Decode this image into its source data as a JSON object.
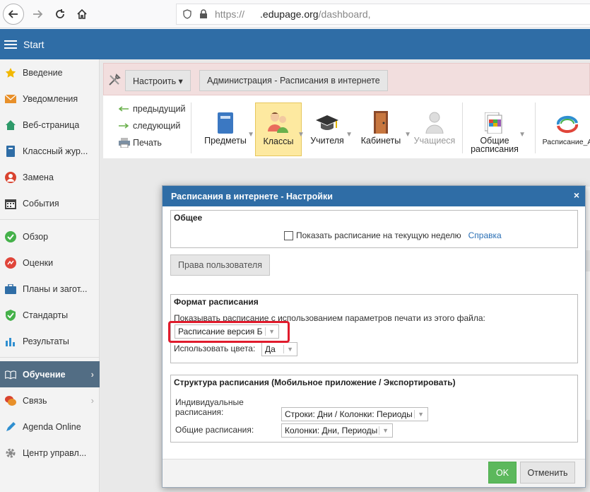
{
  "browser": {
    "url_scheme": "https://",
    "url_host": ".edupage.org",
    "url_path": "/dashboard,"
  },
  "header": {
    "title": "Start"
  },
  "sidebar": {
    "items": [
      {
        "label": "Введение",
        "icon": "star-icon"
      },
      {
        "label": "Уведомления",
        "icon": "envelope-icon"
      },
      {
        "label": "Веб-страница",
        "icon": "home-icon"
      },
      {
        "label": "Классный жур...",
        "icon": "book-icon"
      },
      {
        "label": "Замена",
        "icon": "person-icon"
      },
      {
        "label": "События",
        "icon": "calendar-icon"
      },
      {
        "label": "Обзор",
        "icon": "check-circle-icon"
      },
      {
        "label": "Оценки",
        "icon": "grades-icon"
      },
      {
        "label": "Планы и загот...",
        "icon": "briefcase-icon"
      },
      {
        "label": "Стандарты",
        "icon": "shield-check-icon"
      },
      {
        "label": "Результаты",
        "icon": "bar-chart-icon"
      },
      {
        "label": "Обучение",
        "icon": "open-book-icon"
      },
      {
        "label": "Связь",
        "icon": "chat-icon"
      },
      {
        "label": "Agenda Online",
        "icon": "pen-icon"
      },
      {
        "label": "Центр управл...",
        "icon": "gear-icon"
      }
    ]
  },
  "toolbar": {
    "configure_label": "Настроить ▾",
    "admin_label": "Администрация - Расписания в интернете",
    "prev_label": "предыдущий",
    "next_label": "следующий",
    "print_label": "Печать",
    "subjects_label": "Предметы",
    "classes_label": "Классы",
    "teachers_label": "Учителя",
    "rooms_label": "Кабинеты",
    "students_label": "Учащиеся",
    "general_label_1": "Общие",
    "general_label_2": "расписания",
    "schedule_a_label": "Расписание_А"
  },
  "modal": {
    "title": "Расписания в интернете - Настройки",
    "close": "×",
    "general": {
      "title": "Общее",
      "show_week_label": "Показать расписание на текущую неделю",
      "help_link": "Справка"
    },
    "user_rights_button": "Права пользователя",
    "format": {
      "title": "Формат расписания",
      "description": "Показывать расписание с использованием параметров печати из этого файла:",
      "file_value": "Расписание версия Б",
      "colors_label": "Использовать цвета:",
      "colors_value": "Да"
    },
    "structure": {
      "title": "Структура расписания (Мобильное приложение / Экспортировать)",
      "individual_label_1": "Индивидуальные",
      "individual_label_2": "расписания:",
      "individual_value": "Строки: Дни / Колонки: Периоды",
      "general_label": "Общие расписания:",
      "general_value": "Колонки: Дни, Периоды"
    },
    "ok_label": "OK",
    "cancel_label": "Отменить"
  },
  "colors": {
    "header_blue": "#2f6da6",
    "sidebar_active": "#526d84",
    "ok_green": "#5cb85c",
    "highlight_red": "#e01b2c",
    "selected_tool": "#fde9a0"
  }
}
